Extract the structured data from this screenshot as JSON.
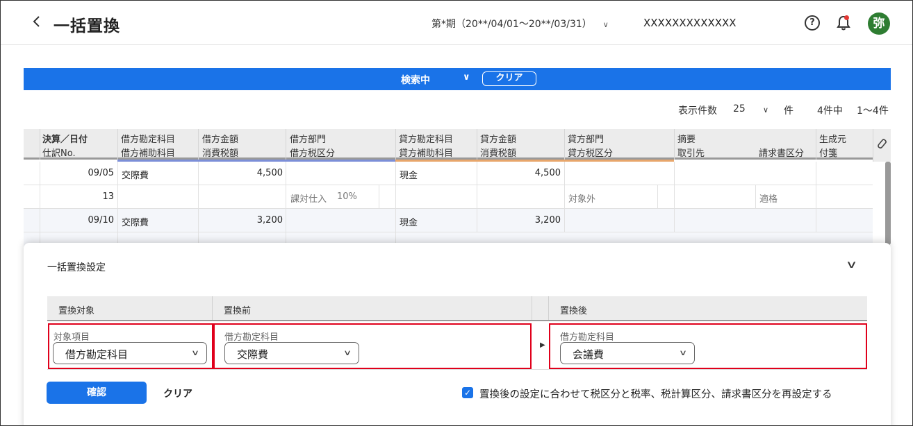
{
  "header": {
    "back_icon": "chevron-left-icon",
    "title": "一括置換",
    "period": "第*期（20**/04/01〜20**/03/31）",
    "company": "XXXXXXXXXXXXX",
    "avatar_text": "弥",
    "avatar_color": "#2e7d32"
  },
  "banner": {
    "label": "検索中",
    "clear": "クリア",
    "color": "#1a73e8"
  },
  "pager": {
    "display_count_label": "表示件数",
    "display_count": "25",
    "unit": "件",
    "total": "4件中",
    "range": "1〜4件"
  },
  "table": {
    "header_row1": [
      "決算／日付",
      "借方勘定科目",
      "借方金額",
      "借方部門",
      "貸方勘定科目",
      "貸方金額",
      "貸方部門",
      "摘要",
      "生成元"
    ],
    "header_row2": [
      "仕訳No.",
      "借方補助科目",
      "消費税額",
      "借方税区分",
      "貸方補助科目",
      "消費税額",
      "貸方税区分",
      "取引先",
      "請求書区分",
      "付箋"
    ],
    "rows": [
      {
        "date": "09/05",
        "debit_account": "交際費",
        "debit_amount": "4,500",
        "credit_account": "現金",
        "credit_amount": "4,500",
        "no": "13",
        "debit_tax": "課対仕入",
        "debit_rate": "10%",
        "credit_tax": "対象外",
        "invoice": "適格"
      },
      {
        "date": "09/10",
        "debit_account": "交際費",
        "debit_amount": "3,200",
        "credit_account": "現金",
        "credit_amount": "3,200"
      }
    ]
  },
  "panel": {
    "title": "一括置換設定",
    "columns": [
      "置換対象",
      "置換前",
      "置換後"
    ],
    "target": {
      "label": "対象項目",
      "value": "借方勘定科目"
    },
    "before": {
      "label": "借方勘定科目",
      "value": "交際費"
    },
    "after": {
      "label": "借方勘定科目",
      "value": "会議費"
    },
    "confirm": "確認",
    "clear": "クリア",
    "checkbox_checked": true,
    "checkbox_label": "置換後の設定に合わせて税区分と税率、税計算区分、請求書区分を再設定する",
    "highlight_color": "#e0001b"
  }
}
